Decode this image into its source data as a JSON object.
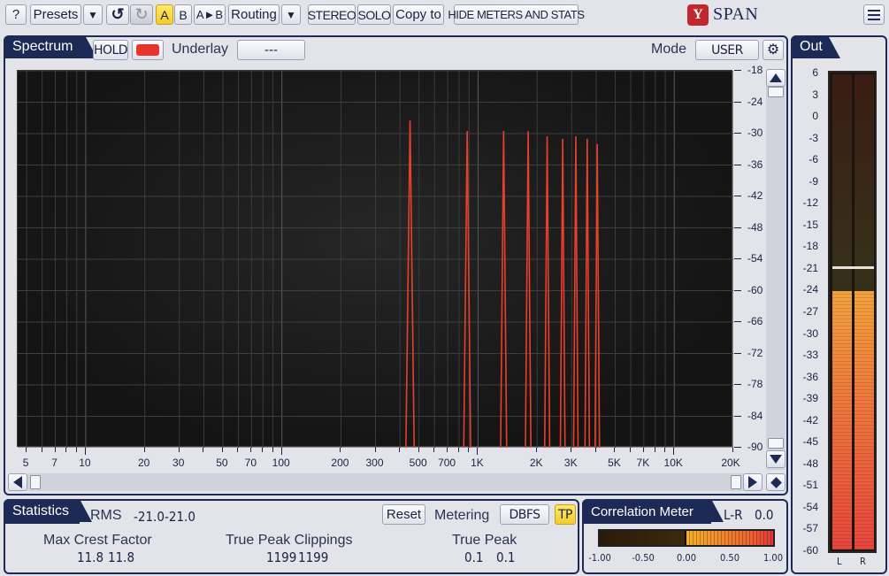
{
  "toolbar": {
    "help": "?",
    "presets": "Presets",
    "dropdown": "▼",
    "undo": "↺",
    "redo": "↻",
    "a": "A",
    "b": "B",
    "a_to_b": "A►B",
    "routing": "Routing",
    "stereo": "STEREO",
    "solo": "SOLO",
    "copy_to": "Copy to",
    "hide_meters": "HIDE METERS AND STATS",
    "brand": "SPAN",
    "brand_logo": "Y"
  },
  "spectrum": {
    "tab": "Spectrum",
    "hold": "HOLD",
    "underlay_label": "Underlay",
    "underlay_value": "---",
    "mode_label": "Mode",
    "mode_value": "USER",
    "y_ticks": [
      "-18",
      "-24",
      "-30",
      "-36",
      "-42",
      "-48",
      "-54",
      "-60",
      "-66",
      "-72",
      "-78",
      "-84",
      "-90"
    ],
    "x_ticks": [
      "5",
      "7",
      "10",
      "20",
      "30",
      "50",
      "70",
      "100",
      "200",
      "300",
      "500",
      "700",
      "1K",
      "2K",
      "3K",
      "5K",
      "7K",
      "10K",
      "20K"
    ],
    "peaks": [
      {
        "freq": 450,
        "db": -27.5
      },
      {
        "freq": 880,
        "db": -29.5
      },
      {
        "freq": 1350,
        "db": -29.5
      },
      {
        "freq": 1800,
        "db": -29.5
      },
      {
        "freq": 2250,
        "db": -30.5
      },
      {
        "freq": 2700,
        "db": -31.0
      },
      {
        "freq": 3150,
        "db": -30.5
      },
      {
        "freq": 3600,
        "db": -31.0
      },
      {
        "freq": 4050,
        "db": -32.0
      }
    ],
    "line_color": "#e8402c"
  },
  "statistics": {
    "tab": "Statistics",
    "rms_label": "RMS",
    "rms_l": "-21.0",
    "rms_r": "-21.0",
    "reset": "Reset",
    "metering_label": "Metering",
    "metering_value": "DBFS",
    "tp": "TP",
    "max_crest_label": "Max Crest Factor",
    "max_crest_l": "11.8",
    "max_crest_r": "11.8",
    "tp_clip_label": "True Peak Clippings",
    "tp_clip_l": "1199",
    "tp_clip_r": "1199",
    "true_peak_label": "True Peak",
    "true_peak_l": "0.1",
    "true_peak_r": "0.1"
  },
  "correlation": {
    "tab": "Correlation Meter",
    "lr_label": "L-R",
    "lr_value": "0.0",
    "ticks": [
      "-1.00",
      "-0.50",
      "0.00",
      "0.50",
      "1.00"
    ]
  },
  "out": {
    "tab": "Out",
    "ticks": [
      "6",
      "3",
      "0",
      "-3",
      "-6",
      "-9",
      "-12",
      "-15",
      "-18",
      "-21",
      "-24",
      "-27",
      "-30",
      "-33",
      "-36",
      "-39",
      "-42",
      "-45",
      "-48",
      "-51",
      "-54",
      "-57",
      "-60"
    ],
    "level_db": -24.0,
    "peak_hold_db": -20.5,
    "left": "L",
    "right": "R"
  }
}
